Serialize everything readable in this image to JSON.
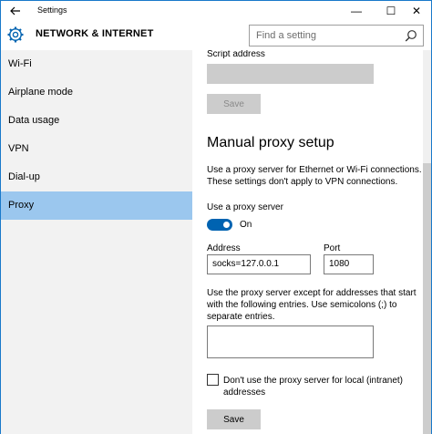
{
  "titlebar": {
    "title": "Settings",
    "back_icon": "back-arrow-icon",
    "minimize_glyph": "—",
    "maximize_glyph": "☐",
    "close_glyph": "✕"
  },
  "header": {
    "title": "NETWORK & INTERNET",
    "icon": "gear-icon",
    "search_placeholder": "Find a setting"
  },
  "sidebar": {
    "items": [
      {
        "label": "Wi-Fi",
        "selected": false
      },
      {
        "label": "Airplane mode",
        "selected": false
      },
      {
        "label": "Data usage",
        "selected": false
      },
      {
        "label": "VPN",
        "selected": false
      },
      {
        "label": "Dial-up",
        "selected": false
      },
      {
        "label": "Proxy",
        "selected": true
      }
    ]
  },
  "content": {
    "script_address_label": "Script address",
    "script_save_label": "Save",
    "manual_title": "Manual proxy setup",
    "manual_desc_1": "Use a proxy server for Ethernet or Wi-Fi connections.",
    "manual_desc_2": "These settings don't apply to VPN connections.",
    "use_proxy_label": "Use a proxy server",
    "toggle_state": "On",
    "address_label": "Address",
    "address_value": "socks=127.0.0.1",
    "port_label": "Port",
    "port_value": "1080",
    "exceptions_1": "Use the proxy server except for addresses that start",
    "exceptions_2": "with the following entries. Use semicolons (;) to",
    "exceptions_3": "separate entries.",
    "exceptions_value": "",
    "local_checkbox_1": "Don't use the proxy server for local (intranet)",
    "local_checkbox_2": "addresses",
    "local_checkbox_checked": false,
    "save_label": "Save"
  },
  "colors": {
    "accent": "#0063b1",
    "selected_nav": "#9bc7ee",
    "sidebar_bg": "#f2f2f2",
    "window_border": "#1979ca"
  }
}
